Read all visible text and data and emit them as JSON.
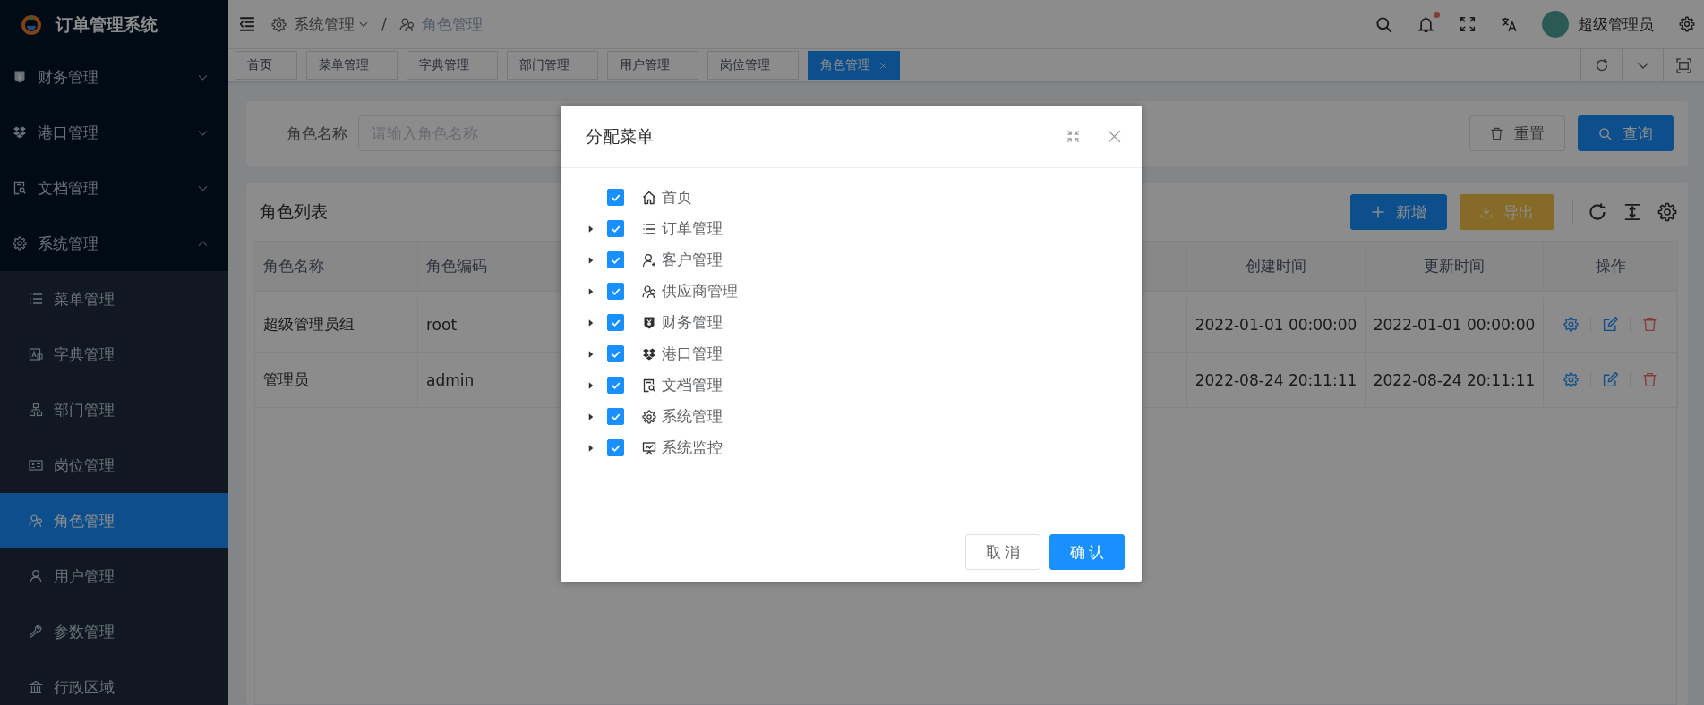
{
  "app": {
    "title": "订单管理系统"
  },
  "sidebar": {
    "items": [
      {
        "label": "财务管理",
        "expanded": false
      },
      {
        "label": "港口管理",
        "expanded": false
      },
      {
        "label": "文档管理",
        "expanded": false
      },
      {
        "label": "系统管理",
        "expanded": true,
        "children": [
          {
            "label": "菜单管理",
            "selected": false
          },
          {
            "label": "字典管理",
            "selected": false
          },
          {
            "label": "部门管理",
            "selected": false
          },
          {
            "label": "岗位管理",
            "selected": false
          },
          {
            "label": "角色管理",
            "selected": true
          },
          {
            "label": "用户管理",
            "selected": false
          },
          {
            "label": "参数管理",
            "selected": false
          },
          {
            "label": "行政区域",
            "selected": false
          }
        ]
      }
    ]
  },
  "header": {
    "breadcrumb_separator": "/",
    "breadcrumb": [
      {
        "label": "系统管理",
        "dropdown": true
      },
      {
        "label": "角色管理",
        "dropdown": false
      }
    ],
    "notification_dot": true,
    "user": {
      "name": "超级管理员"
    }
  },
  "tabs": [
    {
      "label": "首页",
      "selected": false,
      "closable": false
    },
    {
      "label": "菜单管理",
      "selected": false,
      "closable": false
    },
    {
      "label": "字典管理",
      "selected": false,
      "closable": false
    },
    {
      "label": "部门管理",
      "selected": false,
      "closable": false
    },
    {
      "label": "用户管理",
      "selected": false,
      "closable": false
    },
    {
      "label": "岗位管理",
      "selected": false,
      "closable": false
    },
    {
      "label": "角色管理",
      "selected": true,
      "closable": true
    }
  ],
  "search": {
    "label": "角色名称",
    "placeholder": "请输入角色名称",
    "buttons": [
      {
        "label": "重置",
        "kind": "reset"
      },
      {
        "label": "查询",
        "kind": "search"
      }
    ]
  },
  "table": {
    "title": "角色列表",
    "actions": [
      {
        "label": "新增",
        "kind": "add"
      },
      {
        "label": "导出",
        "kind": "export"
      }
    ],
    "columns": [
      "角色名称",
      "角色编码",
      "创建时间",
      "更新时间",
      "操作"
    ],
    "rows": [
      {
        "cells": [
          "超级管理员组",
          "root",
          "2022-01-01 00:00:00",
          "2022-01-01 00:00:00"
        ]
      },
      {
        "cells": [
          "管理员",
          "admin",
          "2022-08-24 20:11:11",
          "2022-08-24 20:11:11"
        ]
      }
    ]
  },
  "dialog": {
    "title": "分配菜单",
    "tree": [
      {
        "label": "首页",
        "checked": true,
        "expandable": false
      },
      {
        "label": "订单管理",
        "checked": true,
        "expandable": true
      },
      {
        "label": "客户管理",
        "checked": true,
        "expandable": true
      },
      {
        "label": "供应商管理",
        "checked": true,
        "expandable": true
      },
      {
        "label": "财务管理",
        "checked": true,
        "expandable": true
      },
      {
        "label": "港口管理",
        "checked": true,
        "expandable": true
      },
      {
        "label": "文档管理",
        "checked": true,
        "expandable": true
      },
      {
        "label": "系统管理",
        "checked": true,
        "expandable": true
      },
      {
        "label": "系统监控",
        "checked": true,
        "expandable": true
      }
    ],
    "buttons": [
      {
        "label": "取消",
        "kind": "cancel"
      },
      {
        "label": "确认",
        "kind": "primary"
      }
    ]
  }
}
